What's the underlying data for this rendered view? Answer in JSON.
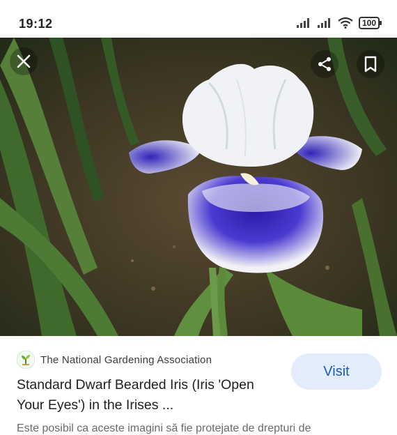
{
  "status_bar": {
    "time": "19:12",
    "battery": "100",
    "icons": [
      "signal-icon",
      "signal-icon",
      "wifi-icon",
      "battery-icon"
    ]
  },
  "image_viewer": {
    "controls": [
      "close-icon",
      "share-icon",
      "bookmark-icon"
    ]
  },
  "result": {
    "source": "The National Gardening Association",
    "title": "Standard Dwarf Bearded Iris (Iris 'Open Your Eyes') in the Irises ...",
    "visit_label": "Visit",
    "disclaimer": "Este posibil ca aceste imagini să fie protejate de drepturi de"
  },
  "colors": {
    "visit_bg": "#e3ecfa",
    "visit_text": "#1b5bb5",
    "petal_white": "#f4f4f6",
    "petal_blue": "#3a2bc0"
  }
}
